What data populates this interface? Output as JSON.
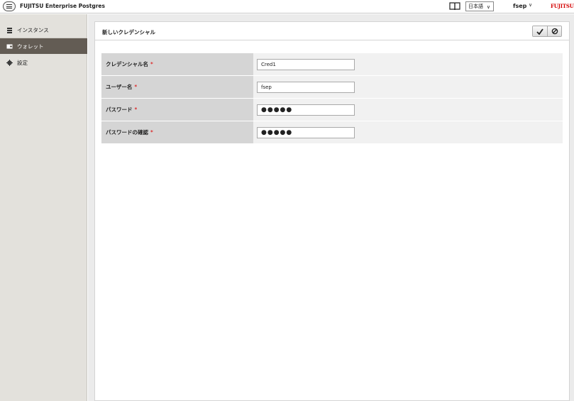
{
  "header": {
    "app_title": "FUJITSU Enterprise Postgres",
    "language": "日本語",
    "user": "fsep",
    "brand": "FUJITSU"
  },
  "sidebar": {
    "items": [
      {
        "label": "インスタンス",
        "icon": "database-icon",
        "active": false
      },
      {
        "label": "ウォレット",
        "icon": "wallet-icon",
        "active": true
      },
      {
        "label": "設定",
        "icon": "gear-icon",
        "active": false
      }
    ]
  },
  "panel": {
    "title": "新しいクレデンシャル",
    "save_icon": "check-icon",
    "cancel_icon": "cancel-icon"
  },
  "form": {
    "required_mark": "*",
    "fields": [
      {
        "label": "クレデンシャル名",
        "value": "Cred1",
        "type": "text"
      },
      {
        "label": "ユーザー名",
        "value": "fsep",
        "type": "text"
      },
      {
        "label": "パスワード",
        "value": "●●●●●",
        "type": "password"
      },
      {
        "label": "パスワードの確認",
        "value": "●●●●●",
        "type": "password"
      }
    ]
  },
  "colors": {
    "sidebar_bg": "#e3e1dc",
    "sidebar_active": "#635c54",
    "required": "#dd0000",
    "brand": "#d40000"
  }
}
